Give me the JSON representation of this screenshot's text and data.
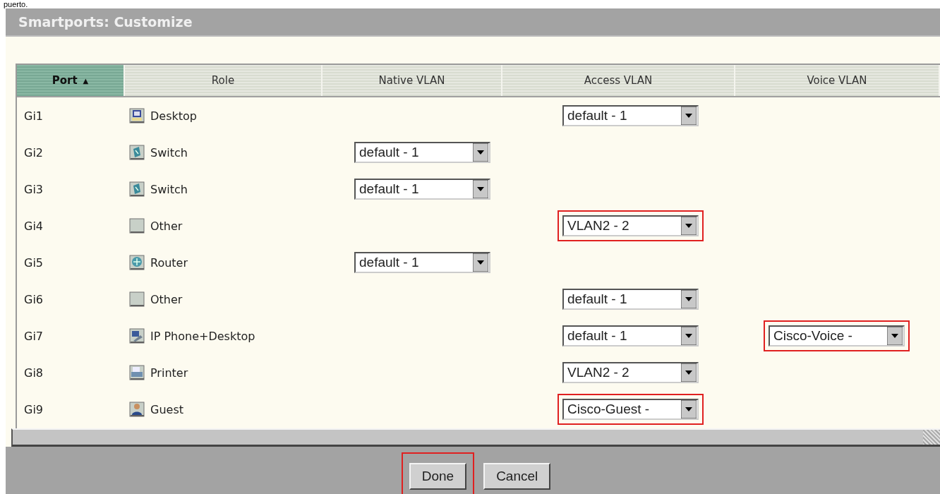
{
  "caption": "puerto.",
  "window": {
    "title": "Smartports: Customize"
  },
  "table": {
    "columns": [
      {
        "label": "Port",
        "sort_indicator": "▲",
        "selected": true
      },
      {
        "label": "Role",
        "selected": false
      },
      {
        "label": "Native VLAN",
        "selected": false
      },
      {
        "label": "Access VLAN",
        "selected": false
      },
      {
        "label": "Voice VLAN",
        "selected": false
      }
    ],
    "rows": [
      {
        "port": "Gi1",
        "kind": "desktop",
        "role": "Desktop",
        "access_vlan": {
          "value": "default - 1",
          "highlighted": false
        }
      },
      {
        "port": "Gi2",
        "kind": "switch",
        "role": "Switch",
        "native_vlan": {
          "value": "default - 1",
          "highlighted": false
        }
      },
      {
        "port": "Gi3",
        "kind": "switch",
        "role": "Switch",
        "native_vlan": {
          "value": "default - 1",
          "highlighted": false
        }
      },
      {
        "port": "Gi4",
        "kind": "other",
        "role": "Other",
        "access_vlan": {
          "value": "VLAN2 - 2",
          "highlighted": true
        }
      },
      {
        "port": "Gi5",
        "kind": "router",
        "role": "Router",
        "native_vlan": {
          "value": "default - 1",
          "highlighted": false
        }
      },
      {
        "port": "Gi6",
        "kind": "other",
        "role": "Other",
        "access_vlan": {
          "value": "default - 1",
          "highlighted": false
        }
      },
      {
        "port": "Gi7",
        "kind": "phone",
        "role": "IP Phone+Desktop",
        "access_vlan": {
          "value": "default - 1",
          "highlighted": false
        },
        "voice_vlan": {
          "value": "Cisco-Voice -",
          "highlighted": true
        }
      },
      {
        "port": "Gi8",
        "kind": "printer",
        "role": "Printer",
        "access_vlan": {
          "value": "VLAN2 - 2",
          "highlighted": false
        }
      },
      {
        "port": "Gi9",
        "kind": "guest",
        "role": "Guest",
        "access_vlan": {
          "value": "Cisco-Guest -",
          "highlighted": true
        }
      }
    ]
  },
  "buttons": [
    {
      "label": "Done",
      "highlighted": true
    },
    {
      "label": "Cancel",
      "highlighted": false
    }
  ]
}
